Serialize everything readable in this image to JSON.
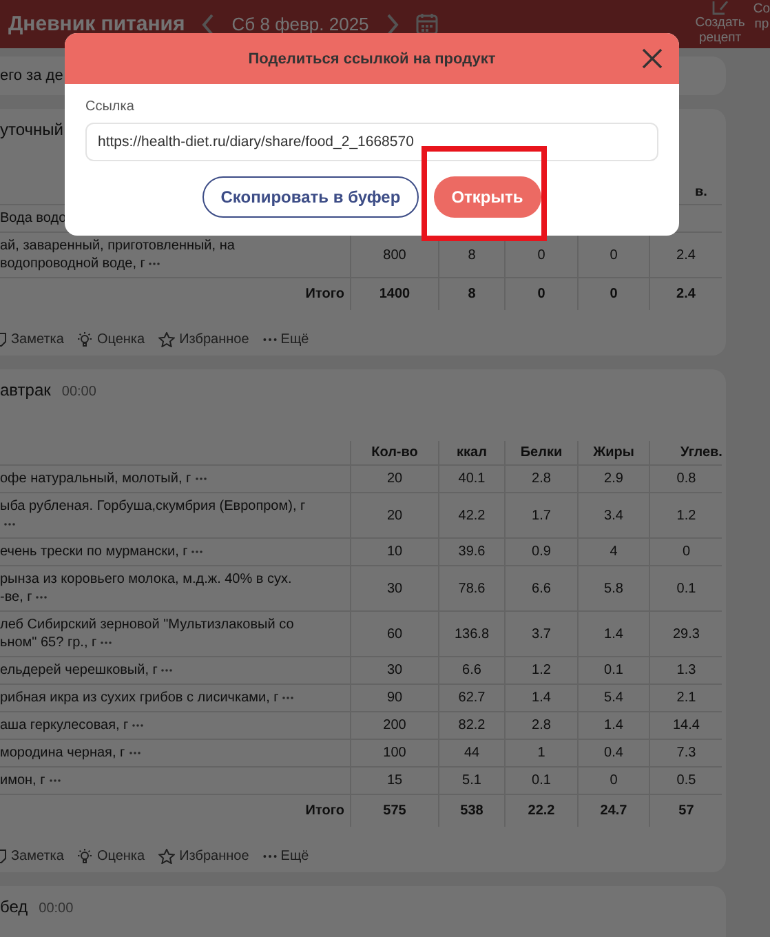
{
  "header": {
    "title": "Дневник питания",
    "date": "Сб 8 февр. 2025",
    "actions": [
      {
        "lines": [
          "Создать",
          "рецепт"
        ]
      },
      {
        "lines": [
          "Со",
          "пр"
        ]
      }
    ]
  },
  "summary": {
    "text": "его за де"
  },
  "meals": [
    {
      "title": "уточный",
      "columns": [
        null,
        null,
        null,
        null,
        "в."
      ],
      "rows": [
        {
          "name_lines": [
            "Вода водо"
          ],
          "values": []
        },
        {
          "name_lines": [
            "ай, заваренный, приготовленный, на",
            "водопроводной воде, г"
          ],
          "values": [
            "800",
            "8",
            "0",
            "0",
            "2.4"
          ]
        }
      ],
      "total": {
        "label": "Итого",
        "values": [
          "1400",
          "8",
          "0",
          "0",
          "2.4"
        ]
      },
      "actions": [
        "Заметка",
        "Оценка",
        "Избранное",
        "Ещё"
      ]
    },
    {
      "title": "автрак",
      "time": "00:00",
      "columns": [
        "Кол-во",
        "ккал",
        "Белки",
        "Жиры",
        "Углев."
      ],
      "rows": [
        {
          "name_lines": [
            "офе натуральный, молотый, г"
          ],
          "values": [
            "20",
            "40.1",
            "2.8",
            "2.9",
            "0.8"
          ]
        },
        {
          "name_lines": [
            "ыба рубленая. Горбуша,скумбрия (Европром), г"
          ],
          "icon_on_new_line": true,
          "values": [
            "20",
            "42.2",
            "1.7",
            "3.4",
            "1.2"
          ]
        },
        {
          "name_lines": [
            "ечень трески по мурмански, г"
          ],
          "values": [
            "10",
            "39.6",
            "0.9",
            "4",
            "0"
          ]
        },
        {
          "name_lines": [
            "рынза из коровьего молока, м.д.ж. 40% в сух.",
            "-ве, г"
          ],
          "values": [
            "30",
            "78.6",
            "6.6",
            "5.8",
            "0.1"
          ]
        },
        {
          "name_lines": [
            "леб Сибирский зерновой \"Мультизлаковый со",
            "ьном\" 65? гр., г"
          ],
          "values": [
            "60",
            "136.8",
            "3.7",
            "1.4",
            "29.3"
          ]
        },
        {
          "name_lines": [
            "ельдерей черешковый, г"
          ],
          "values": [
            "30",
            "6.6",
            "1.2",
            "0.1",
            "1.3"
          ]
        },
        {
          "name_lines": [
            "рибная икра из сухих грибов с лисичками, г"
          ],
          "values": [
            "90",
            "62.7",
            "1.4",
            "5.4",
            "2.1"
          ]
        },
        {
          "name_lines": [
            "аша геркулесовая, г"
          ],
          "values": [
            "200",
            "82.2",
            "2.8",
            "1.4",
            "14.4"
          ]
        },
        {
          "name_lines": [
            "мородина черная, г"
          ],
          "values": [
            "100",
            "44",
            "1",
            "0.4",
            "7.3"
          ]
        },
        {
          "name_lines": [
            "имон, г"
          ],
          "values": [
            "15",
            "5.1",
            "0.1",
            "0",
            "0.5"
          ]
        }
      ],
      "total": {
        "label": "Итого",
        "values": [
          "575",
          "538",
          "22.2",
          "24.7",
          "57"
        ]
      },
      "actions": [
        "Заметка",
        "Оценка",
        "Избранное",
        "Ещё"
      ]
    },
    {
      "title": "бед",
      "time": "00:00"
    }
  ],
  "dialog": {
    "title": "Поделиться ссылкой на продукт",
    "field_label": "Ссылка",
    "value": "https://health-diet.ru/diary/share/food_2_1668570",
    "buttons": [
      {
        "label": "Скопировать в буфер",
        "kind": "outline"
      },
      {
        "label": "Открыть",
        "kind": "primary",
        "highlighted": true
      }
    ]
  }
}
